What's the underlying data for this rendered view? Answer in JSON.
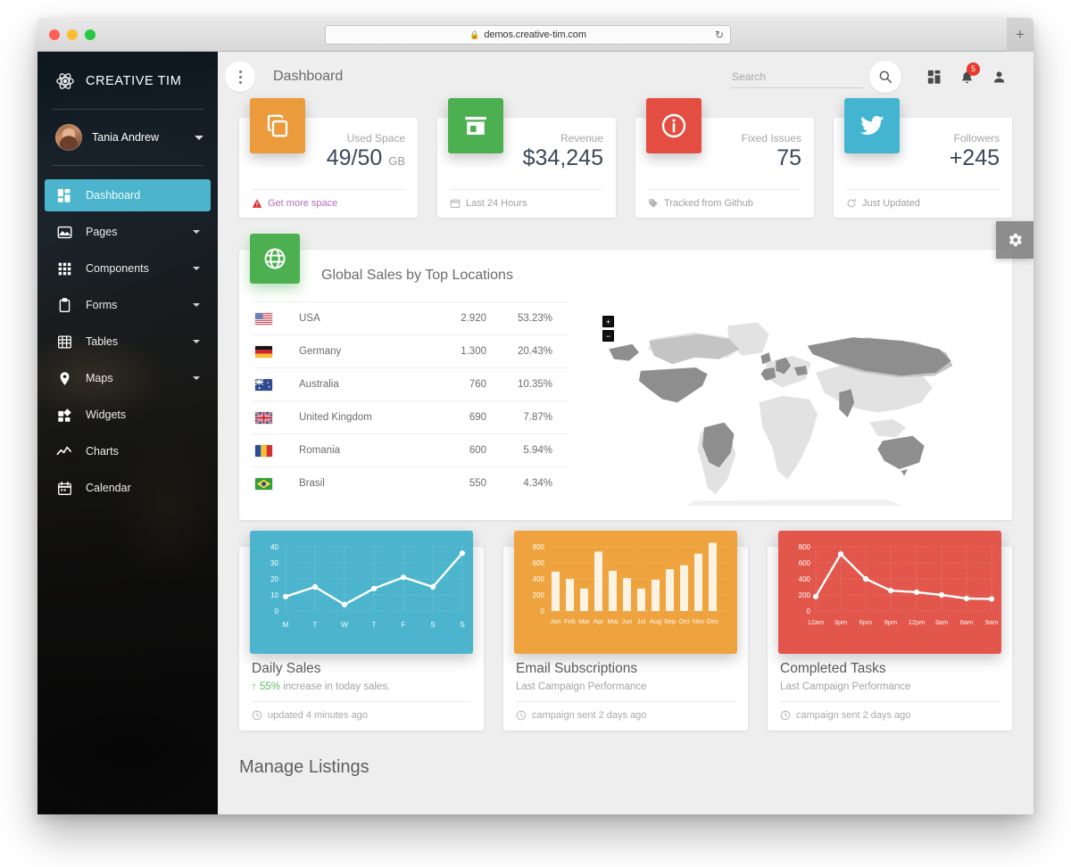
{
  "browser": {
    "url": "demos.creative-tim.com",
    "lock_icon": "lock-icon",
    "reload_icon": "reload-icon",
    "newtab_label": "+"
  },
  "sidebar": {
    "brand": "CREATIVE TIM",
    "brand_icon": "atom-icon",
    "user": {
      "name": "Tania Andrew",
      "avatar": "avatar"
    },
    "items": [
      {
        "label": "Dashboard",
        "icon": "dashboard-icon",
        "active": true,
        "caret": false
      },
      {
        "label": "Pages",
        "icon": "image-icon",
        "active": false,
        "caret": true
      },
      {
        "label": "Components",
        "icon": "grid-icon",
        "active": false,
        "caret": true
      },
      {
        "label": "Forms",
        "icon": "clipboard-icon",
        "active": false,
        "caret": true
      },
      {
        "label": "Tables",
        "icon": "table-icon",
        "active": false,
        "caret": true
      },
      {
        "label": "Maps",
        "icon": "pin-icon",
        "active": false,
        "caret": true
      },
      {
        "label": "Widgets",
        "icon": "widgets-icon",
        "active": false,
        "caret": false
      },
      {
        "label": "Charts",
        "icon": "chart-line-icon",
        "active": false,
        "caret": false
      },
      {
        "label": "Calendar",
        "icon": "calendar-icon",
        "active": false,
        "caret": false
      }
    ]
  },
  "topbar": {
    "title": "Dashboard",
    "menu_icon": "kebab-menu-icon",
    "search_placeholder": "Search",
    "search_value": "",
    "search_icon": "search-icon",
    "dashboard_icon": "app-grid-icon",
    "notifications_icon": "bell-icon",
    "notifications_badge": "5",
    "person_icon": "person-icon"
  },
  "settings_fab": {
    "icon": "gear-icon"
  },
  "stats": [
    {
      "label": "Used Space",
      "value": "49/50",
      "unit": "GB",
      "icon": "copy-icon",
      "color": "#eb9a3c",
      "footer": "Get more space",
      "footer_icon": "warning-icon",
      "footer_warn": true
    },
    {
      "label": "Revenue",
      "value": "$34,245",
      "unit": "",
      "icon": "store-icon",
      "color": "#4caf50",
      "footer": "Last 24 Hours",
      "footer_icon": "calendar-icon",
      "footer_warn": false
    },
    {
      "label": "Fixed Issues",
      "value": "75",
      "unit": "",
      "icon": "info-icon",
      "color": "#e44d42",
      "footer": "Tracked from Github",
      "footer_icon": "tag-icon",
      "footer_warn": false
    },
    {
      "label": "Followers",
      "value": "+245",
      "unit": "",
      "icon": "twitter-icon",
      "color": "#44b5d1",
      "footer": "Just Updated",
      "footer_icon": "refresh-icon",
      "footer_warn": false
    }
  ],
  "global_sales": {
    "title": "Global Sales by Top Locations",
    "icon": "globe-icon",
    "rows": [
      {
        "flag": "flag-usa",
        "country": "USA",
        "value": "2.920",
        "pct": "53.23%"
      },
      {
        "flag": "flag-germany",
        "country": "Germany",
        "value": "1.300",
        "pct": "20.43%"
      },
      {
        "flag": "flag-australia",
        "country": "Australia",
        "value": "760",
        "pct": "10.35%"
      },
      {
        "flag": "flag-uk",
        "country": "United Kingdom",
        "value": "690",
        "pct": "7.87%"
      },
      {
        "flag": "flag-romania",
        "country": "Romania",
        "value": "600",
        "pct": "5.94%"
      },
      {
        "flag": "flag-brasil",
        "country": "Brasil",
        "value": "550",
        "pct": "4.34%"
      }
    ],
    "map": {
      "zoom_in": "+",
      "zoom_out": "−"
    }
  },
  "chart_data": [
    {
      "type": "line",
      "title": "Daily Sales",
      "subtitle_highlight": "55%",
      "subtitle": "increase in today sales.",
      "subtitle_icon": "arrow-up-icon",
      "footer": "updated 4 minutes ago",
      "footer_icon": "clock-icon",
      "color": "#4cb5cd",
      "categories": [
        "M",
        "T",
        "W",
        "T",
        "F",
        "S",
        "S"
      ],
      "values": [
        9,
        15,
        4,
        14,
        21,
        15,
        36
      ],
      "yticks": [
        0,
        10,
        20,
        30,
        40
      ],
      "ylim": [
        0,
        45
      ],
      "xlabel": "",
      "ylabel": "",
      "grid": true,
      "legend": "none"
    },
    {
      "type": "bar",
      "title": "Email Subscriptions",
      "subtitle": "Last Campaign Performance",
      "footer": "campaign sent 2 days ago",
      "footer_icon": "clock-icon",
      "color": "#efa33e",
      "categories": [
        "Jan",
        "Feb",
        "Mar",
        "Apr",
        "Mai",
        "Jun",
        "Jul",
        "Aug",
        "Sep",
        "Oct",
        "Nov",
        "Dec"
      ],
      "values": [
        490,
        400,
        280,
        740,
        500,
        410,
        280,
        390,
        520,
        570,
        715,
        850
      ],
      "yticks": [
        0,
        200,
        400,
        600,
        800
      ],
      "ylim": [
        0,
        900
      ],
      "xlabel": "",
      "ylabel": "",
      "grid": true,
      "legend": "none"
    },
    {
      "type": "line",
      "title": "Completed Tasks",
      "subtitle": "Last Campaign Performance",
      "footer": "campaign sent 2 days ago",
      "footer_icon": "clock-icon",
      "color": "#e2564c",
      "categories": [
        "12am",
        "3pm",
        "6pm",
        "9pm",
        "12pm",
        "3am",
        "6am",
        "9am"
      ],
      "values": [
        180,
        710,
        400,
        255,
        235,
        200,
        155,
        150
      ],
      "yticks": [
        0,
        200,
        400,
        600,
        800
      ],
      "ylim": [
        0,
        900
      ],
      "xlabel": "",
      "ylabel": "",
      "grid": true,
      "legend": "none"
    }
  ],
  "listings": {
    "title": "Manage Listings"
  }
}
